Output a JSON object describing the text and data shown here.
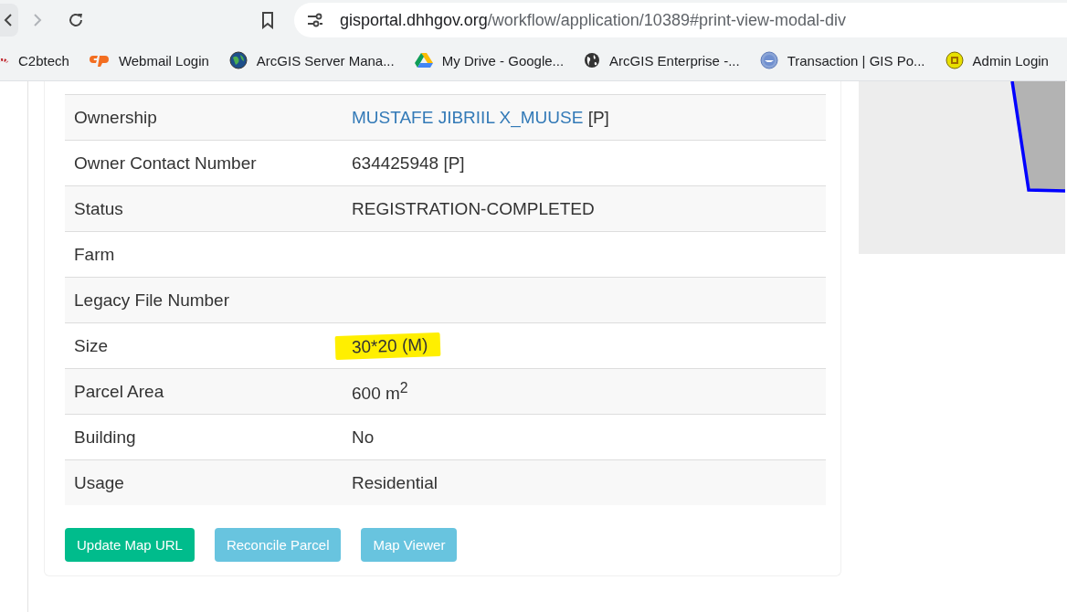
{
  "browser": {
    "forward_disabled": true,
    "url_host": "gisportal.dhhgov.org",
    "url_path": "/workflow/application/10389#print-view-modal-div",
    "bookmarks": [
      {
        "label": "C2btech"
      },
      {
        "label": "Webmail Login"
      },
      {
        "label": "ArcGIS Server Mana..."
      },
      {
        "label": "My Drive - Google..."
      },
      {
        "label": "ArcGIS Enterprise -..."
      },
      {
        "label": "Transaction | GIS Po..."
      },
      {
        "label": "Admin Login"
      }
    ]
  },
  "details": [
    {
      "label": "Ownership",
      "link": "MUSTAFE JIBRIIL X_MUUSE",
      "value": "[P]"
    },
    {
      "label": "Owner Contact Number",
      "value": "634425948 [P]"
    },
    {
      "label": "Status",
      "value": "REGISTRATION-COMPLETED"
    },
    {
      "label": "Farm"
    },
    {
      "label": "Legacy File Number"
    },
    {
      "label": "Size",
      "value": "30*20 (M)",
      "highlighted": true
    },
    {
      "label": "Parcel Area",
      "value": "600 m$^{2}$"
    },
    {
      "label": "Building",
      "value": "No"
    },
    {
      "label": "Usage",
      "value": "Residential"
    }
  ],
  "buttons": [
    {
      "label": "Update Map URL",
      "kind": "success"
    },
    {
      "label": "Reconcile Parcel",
      "kind": "info"
    },
    {
      "label": "Map Viewer",
      "kind": "info"
    }
  ]
}
